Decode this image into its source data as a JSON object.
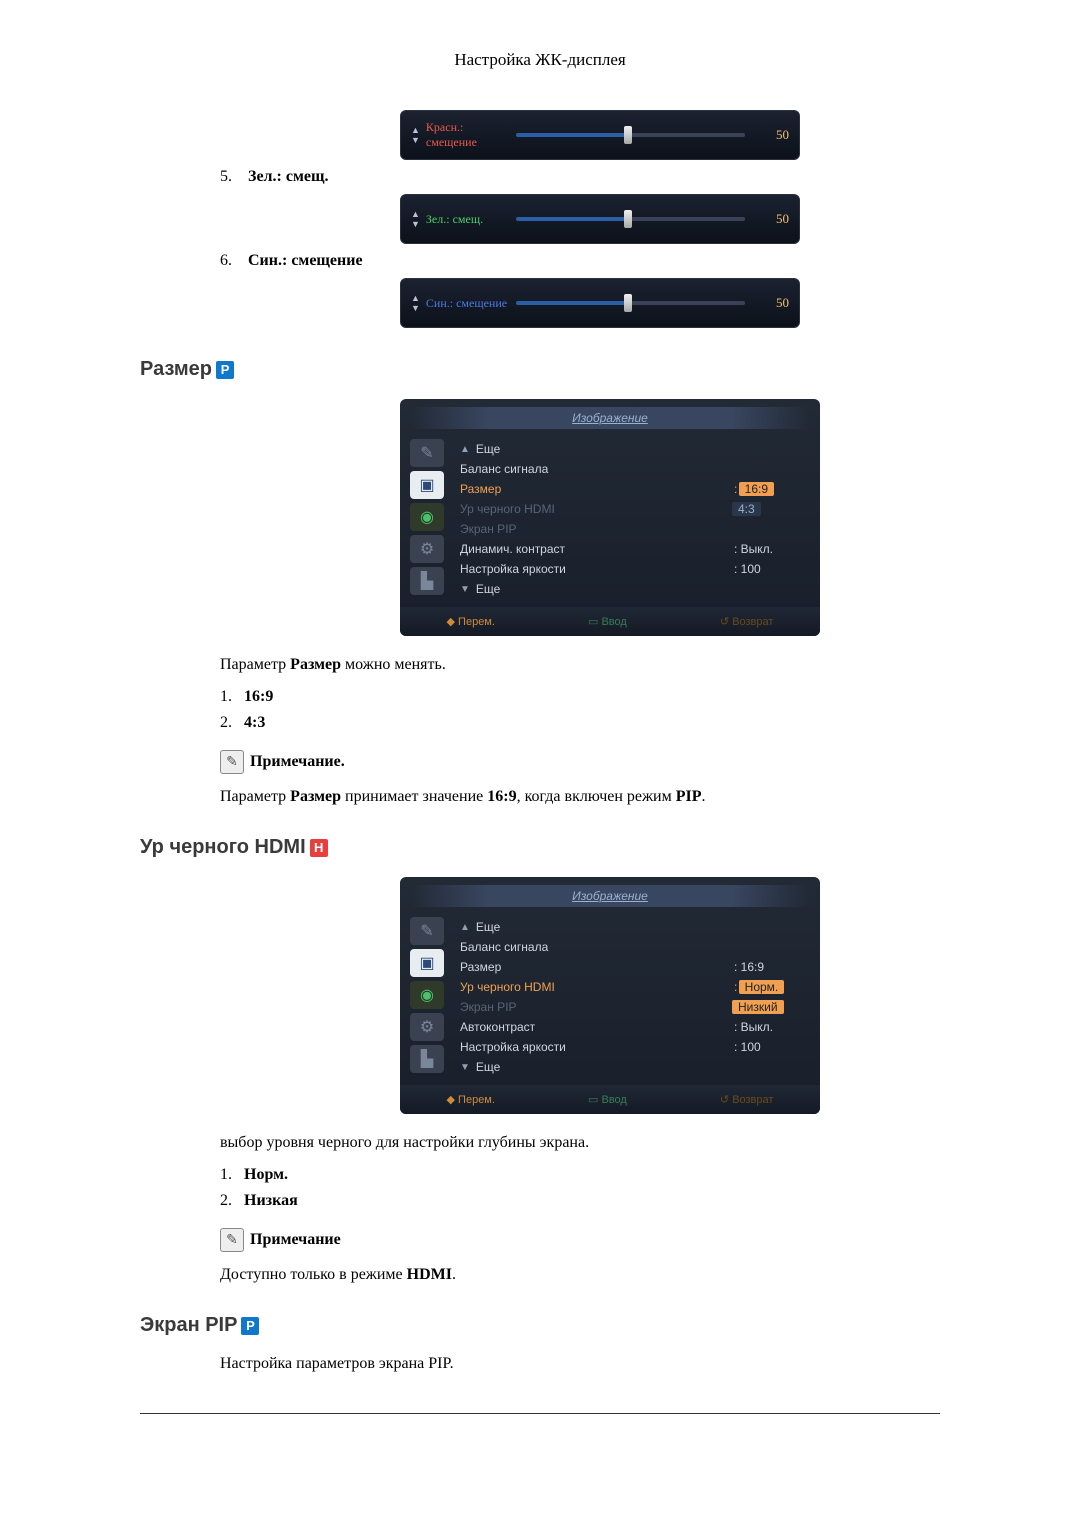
{
  "pageHeader": "Настройка ЖК-дисплея",
  "sliders": {
    "item5": {
      "num": "5.",
      "listLabel": "Зел.: смещ."
    },
    "item6": {
      "num": "6.",
      "listLabel": "Син.: смещение"
    },
    "red": {
      "label": "Красн.: смещение",
      "value": "50"
    },
    "green": {
      "label": "Зел.: смещ.",
      "value": "50"
    },
    "blue": {
      "label": "Син.: смещение",
      "value": "50"
    }
  },
  "sizeSection": {
    "heading": "Размер",
    "tag": "P",
    "text1a": "Параметр ",
    "text1b": "Размер",
    "text1c": " можно менять.",
    "opt1": {
      "num": "1.",
      "label": "16:9"
    },
    "opt2": {
      "num": "2.",
      "label": "4:3"
    },
    "noteLabel": "Примечание.",
    "note_a": "Параметр ",
    "note_b": "Размер",
    "note_c": " принимает значение ",
    "note_d": "16:9",
    "note_e": ", когда включен режим ",
    "note_f": "PIP",
    "note_g": "."
  },
  "hdmiSection": {
    "heading": "Ур черного HDMI",
    "tag": "H",
    "text1": "выбор уровня черного для настройки глубины экрана.",
    "opt1": {
      "num": "1.",
      "label": "Норм."
    },
    "opt2": {
      "num": "2.",
      "label": "Низкая"
    },
    "noteLabel": "Примечание",
    "note_a": "Доступно только в режиме ",
    "note_b": "HDMI",
    "note_c": "."
  },
  "pipSection": {
    "heading": "Экран PIP",
    "tag": "P",
    "text1": "Настройка параметров экрана PIP."
  },
  "osd1": {
    "title": "Изображение",
    "more_up": "Еще",
    "l1": "Баланс сигнала",
    "l2": "Размер",
    "v2": "16:9",
    "v2b": "4:3",
    "l3": "Ур черного HDMI",
    "l4": "Экран PIP",
    "l5": "Динамич. контраст",
    "v5": ": Выкл.",
    "l6": "Настройка яркости",
    "v6": ": 100",
    "more_down": "Еще"
  },
  "osd2": {
    "title": "Изображение",
    "more_up": "Еще",
    "l1": "Баланс сигнала",
    "l2": "Размер",
    "v2": ": 16:9",
    "l3": "Ур черного HDMI",
    "v3a": "Норм.",
    "v3b": "Низкий",
    "l4": "Экран PIP",
    "l5": "Автоконтраст",
    "v5": ": Выкл.",
    "l6": "Настройка яркости",
    "v6": ": 100",
    "more_down": "Еще"
  },
  "osdFooter": {
    "move": "Перем.",
    "enter": "Ввод",
    "back": "Возврат"
  }
}
